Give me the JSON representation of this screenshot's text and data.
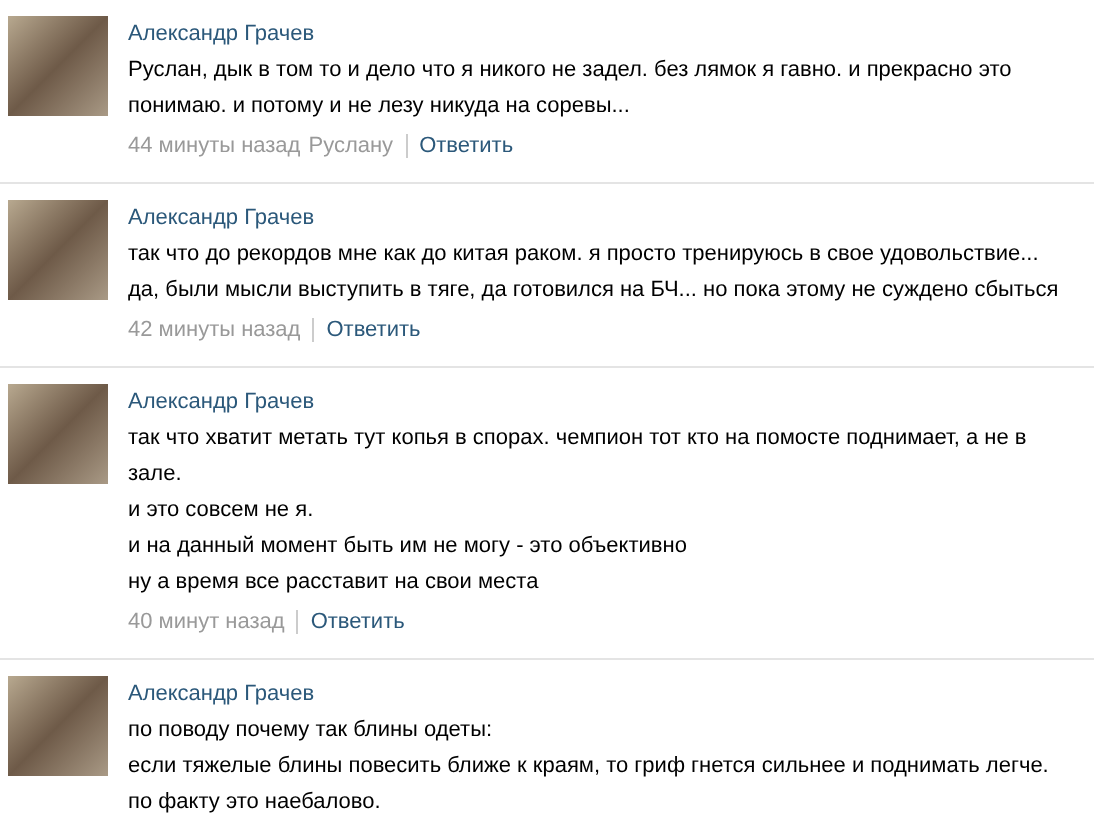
{
  "comments": [
    {
      "author": "Александр Грачев",
      "paragraphs": [
        "Руслан, дык в том то и дело что я никого не задел. без лямок я гавно. и прекрасно это понимаю. и потому и не лезу никуда на соревы..."
      ],
      "time": "44 минуты назад",
      "reply_to": "Руслану",
      "reply_link": "Ответить"
    },
    {
      "author": "Александр Грачев",
      "paragraphs": [
        "так что до рекордов мне как до китая раком. я просто тренируюсь в свое удовольствие...",
        "да, были мысли выступить в тяге, да готовился на БЧ... но пока этому не суждено сбыться"
      ],
      "time": "42 минуты назад",
      "reply_link": "Ответить"
    },
    {
      "author": "Александр Грачев",
      "paragraphs": [
        "так что хватит метать тут копья в спорах. чемпион тот кто на помосте поднимает, а не в зале.",
        "и это совсем не я.",
        "и на данный момент быть им не могу - это объективно",
        "ну а время все расставит на свои места"
      ],
      "time": "40 минут назад",
      "reply_link": "Ответить"
    },
    {
      "author": "Александр Грачев",
      "paragraphs": [
        "по поводу почему так блины одеты:",
        "если тяжелые блины повесить ближе к краям, то гриф гнется сильнее и поднимать легче.",
        "по факту это наебалово."
      ]
    }
  ]
}
